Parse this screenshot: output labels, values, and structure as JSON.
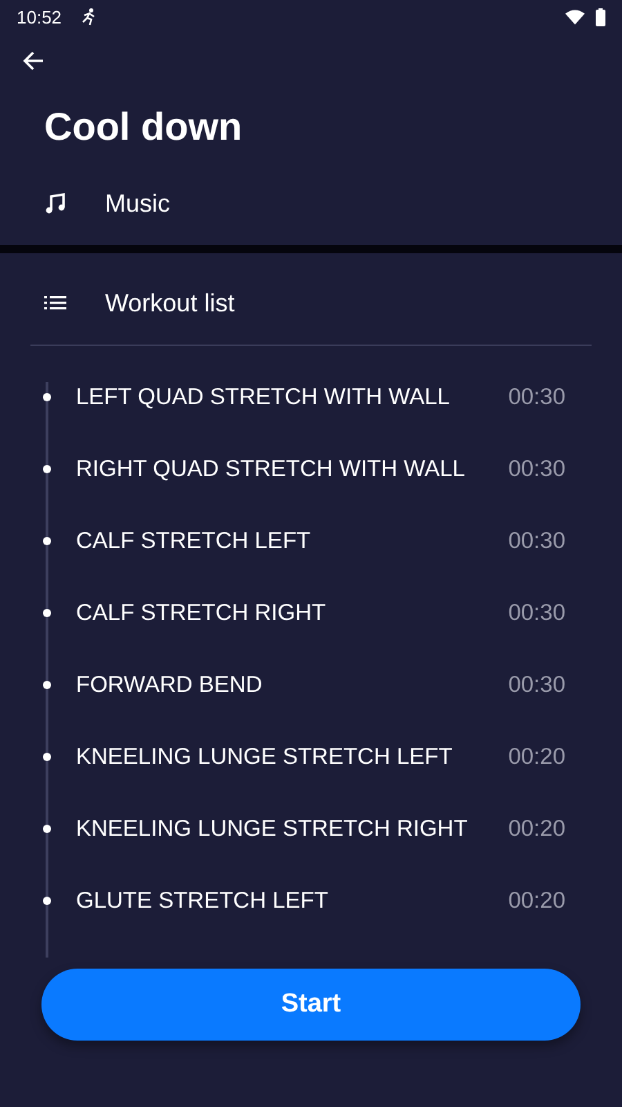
{
  "status_bar": {
    "time": "10:52"
  },
  "title": "Cool down",
  "sections": [
    {
      "kind": "music",
      "label": "Music"
    },
    {
      "kind": "list",
      "label": "Workout list"
    }
  ],
  "exercises": [
    {
      "name": "LEFT QUAD STRETCH WITH WALL",
      "duration": "00:30"
    },
    {
      "name": "RIGHT QUAD STRETCH WITH WALL",
      "duration": "00:30"
    },
    {
      "name": "CALF STRETCH LEFT",
      "duration": "00:30"
    },
    {
      "name": "CALF STRETCH RIGHT",
      "duration": "00:30"
    },
    {
      "name": "FORWARD BEND",
      "duration": "00:30"
    },
    {
      "name": "KNEELING LUNGE STRETCH LEFT",
      "duration": "00:20"
    },
    {
      "name": "KNEELING LUNGE STRETCH RIGHT",
      "duration": "00:20"
    },
    {
      "name": "GLUTE STRETCH LEFT",
      "duration": "00:20"
    }
  ],
  "start_button": "Start"
}
